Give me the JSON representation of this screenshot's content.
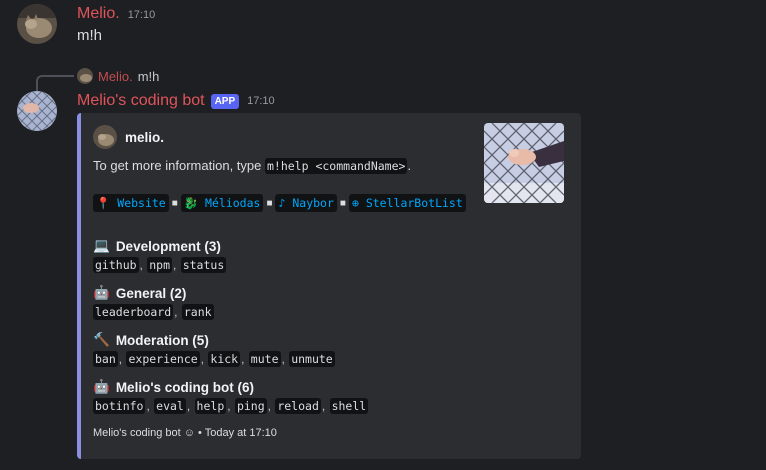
{
  "messages": {
    "first": {
      "username": "Melio.",
      "time": "17:10",
      "content": "m!h"
    },
    "reply_preview": {
      "username": "Melio.",
      "content": "m!h"
    },
    "bot": {
      "username": "Melio's coding bot",
      "tag": "APP",
      "time": "17:10"
    }
  },
  "embed": {
    "author": "melio.",
    "description_prefix": "To get more information, type ",
    "description_code": "m!help <commandName>",
    "description_suffix": ".",
    "links": [
      {
        "emoji": "📍",
        "label": "Website"
      },
      {
        "emoji": "🐉",
        "label": "Méliodas"
      },
      {
        "emoji": "♪",
        "label": "Naybor"
      },
      {
        "emoji": "⊕",
        "label": "StellarBotList"
      }
    ],
    "fields": [
      {
        "emoji": "💻",
        "title": "Development (3)",
        "commands": [
          "github",
          "npm",
          "status"
        ]
      },
      {
        "emoji": "🤖",
        "title": "General (2)",
        "commands": [
          "leaderboard",
          "rank"
        ]
      },
      {
        "emoji": "🔨",
        "title": "Moderation (5)",
        "commands": [
          "ban",
          "experience",
          "kick",
          "mute",
          "unmute"
        ]
      },
      {
        "emoji": "🤖",
        "title": "Melio's coding bot (6)",
        "commands": [
          "botinfo",
          "eval",
          "help",
          "ping",
          "reload",
          "shell"
        ]
      }
    ],
    "footer": "Melio's coding bot ☺ • Today at 17:10"
  },
  "colors": {
    "username_red": "#e0545a",
    "embed_accent": "#8a8fe3",
    "link_blue": "#00a8fc",
    "app_tag": "#5865f2"
  }
}
